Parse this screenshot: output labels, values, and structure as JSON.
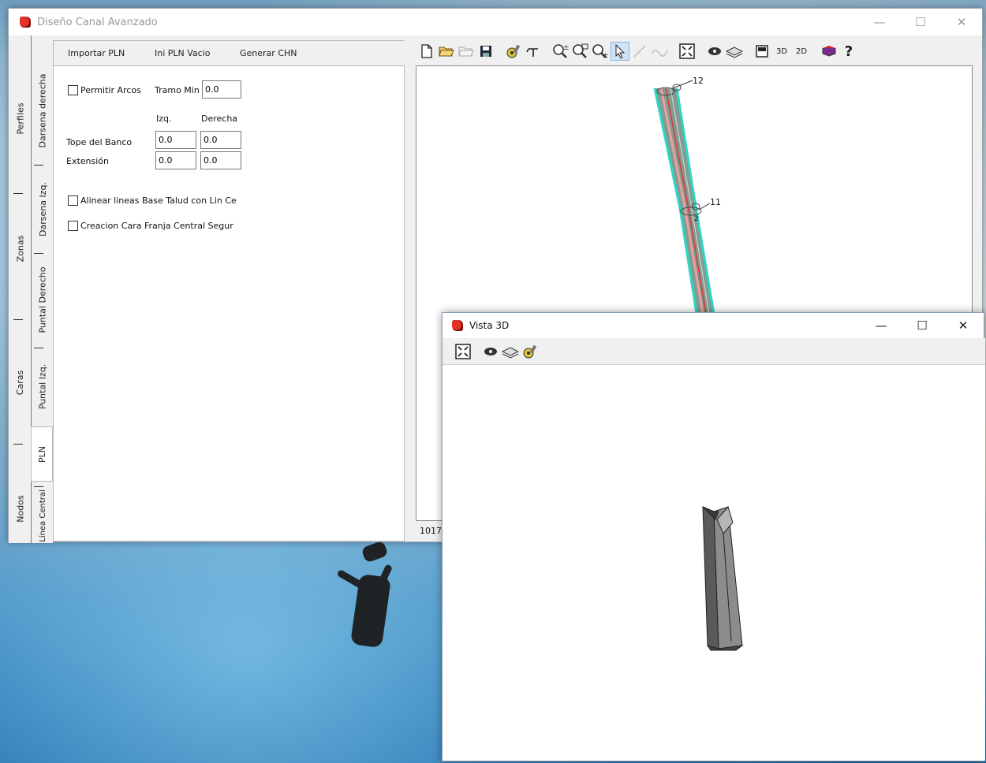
{
  "main_window": {
    "title": "Diseño Canal Avanzado",
    "controls": {
      "minimize": "—",
      "maximize": "☐",
      "close": "✕"
    }
  },
  "side_tabs": [
    {
      "label": "Perfiles"
    },
    {
      "label": "Darsena derecha"
    },
    {
      "label": "Darsena Izq."
    },
    {
      "label": "Zonas"
    },
    {
      "label": "Puntal Derecho"
    },
    {
      "label": "Caras"
    },
    {
      "label": "Puntal Izq."
    },
    {
      "label": "PLN"
    },
    {
      "label": "Nodos"
    },
    {
      "label": "Línea Central"
    }
  ],
  "top_tabs": {
    "importar": "Importar PLN",
    "ini": "Ini PLN Vacio",
    "generar": "Generar CHN"
  },
  "form": {
    "permitir_arcos": "Permitir Arcos",
    "tramo_min_label": "Tramo Min",
    "tramo_min_value": "0.0",
    "col_izq": "Izq.",
    "col_der": "Derecha",
    "tope_label": "Tope del Banco",
    "tope_izq": "0.0",
    "tope_der": "0.0",
    "extension_label": "Extensión",
    "ext_izq": "0.0",
    "ext_der": "0.0",
    "alinear": "Alinear lineas Base Talud con Lin Ce",
    "creacion": "Creacion Cara Franja Central Segur"
  },
  "toolbar_icons": [
    "new-file-icon",
    "open-folder-icon",
    "open-folder-disabled-icon",
    "save-icon",
    "settings-gear-icon",
    "section-icon",
    "zoom-in-icon",
    "zoom-window-icon",
    "zoom-out-icon",
    "select-pointer-icon",
    "line-disabled-icon",
    "curve-disabled-icon",
    "fit-extents-icon",
    "render-icon",
    "layers-icon",
    "panel-icon",
    "3d-icon",
    "2d-icon",
    "book-icon",
    "help-icon"
  ],
  "toolbar_text": {
    "three_d": "3D",
    "two_d": "2D",
    "help": "?"
  },
  "canvas": {
    "label_top": "12",
    "label_mid": "11",
    "label_node": "2",
    "status_coord": "1017"
  },
  "win3d": {
    "title": "Vista 3D",
    "controls": {
      "minimize": "—",
      "maximize": "☐",
      "close": "✕"
    },
    "toolbar_icons": [
      "fit-extents-icon",
      "render-icon",
      "layers-icon",
      "settings-gear-icon"
    ]
  },
  "colors": {
    "canal_outline": "#2ed6c8",
    "canal_center": "#d63a3a",
    "canal_body": "#7a8f86",
    "model_dark": "#4a4a4a",
    "model_light": "#9a9a9a"
  }
}
